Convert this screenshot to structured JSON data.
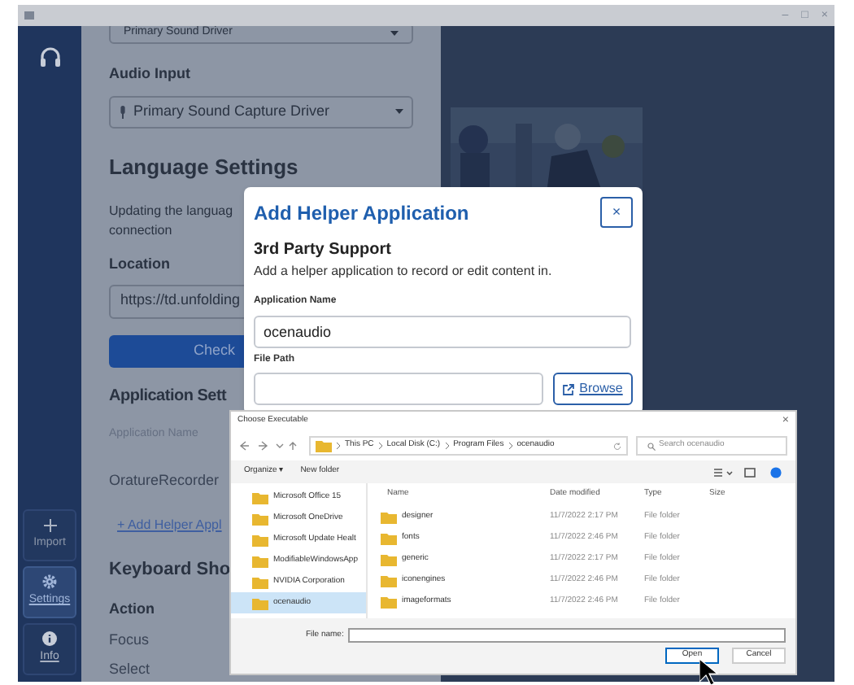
{
  "window": {
    "controls": [
      "–",
      "□",
      "×"
    ]
  },
  "sidebar": {
    "items": [
      {
        "kind": "import",
        "label": "Import",
        "selected": false
      },
      {
        "kind": "settings",
        "label": "Settings",
        "selected": true
      },
      {
        "kind": "info",
        "label": "Info",
        "selected": false
      }
    ]
  },
  "settings": {
    "audio_output": "Primary Sound Driver",
    "audio_input_label": "Audio Input",
    "audio_input": "Primary Sound Capture Driver",
    "language_heading": "Language Settings",
    "language_text": [
      "Updating the languag",
      "connection"
    ],
    "location_label": "Location",
    "location_value": "https://td.unfolding",
    "check_button": "Check",
    "app_heading": "Application Sett",
    "app_name_label": "Application Name",
    "app_name": "OratureRecorder",
    "add_helper_link": "+ Add Helper Appl",
    "keyboard_heading": "Keyboard Sho",
    "action_label": "Action",
    "actions": [
      "Focus",
      "Select"
    ]
  },
  "helper_dialog": {
    "title": "Add Helper Application",
    "close": "×",
    "section": "3rd Party Support",
    "description": "Add a helper application to record or edit content in.",
    "name_label": "Application Name",
    "name_value": "ocenaudio",
    "path_label": "File Path",
    "browse": "Browse"
  },
  "file_dialog": {
    "title": "Choose Executable",
    "close": "×",
    "breadcrumb": [
      "This PC",
      "Local Disk (C:)",
      "Program Files",
      "ocenaudio"
    ],
    "search_placeholder": "Search ocenaudio",
    "organize": "Organize ▾",
    "new_folder": "New folder",
    "tree": [
      {
        "label": "Microsoft Office 15",
        "selected": false
      },
      {
        "label": "Microsoft OneDrive",
        "selected": false
      },
      {
        "label": "Microsoft Update Healt",
        "selected": false
      },
      {
        "label": "ModifiableWindowsApp",
        "selected": false
      },
      {
        "label": "NVIDIA Corporation",
        "selected": false
      },
      {
        "label": "ocenaudio",
        "selected": true
      }
    ],
    "columns": [
      "Name",
      "Date modified",
      "Type",
      "Size"
    ],
    "rows": [
      {
        "name": "designer",
        "date": "11/7/2022 2:17 PM",
        "type": "File folder"
      },
      {
        "name": "fonts",
        "date": "11/7/2022 2:46 PM",
        "type": "File folder"
      },
      {
        "name": "generic",
        "date": "11/7/2022 2:17 PM",
        "type": "File folder"
      },
      {
        "name": "iconengines",
        "date": "11/7/2022 2:46 PM",
        "type": "File folder"
      },
      {
        "name": "imageformats",
        "date": "11/7/2022 2:46 PM",
        "type": "File folder"
      }
    ],
    "file_name_label": "File name:",
    "open": "Open",
    "cancel": "Cancel"
  }
}
